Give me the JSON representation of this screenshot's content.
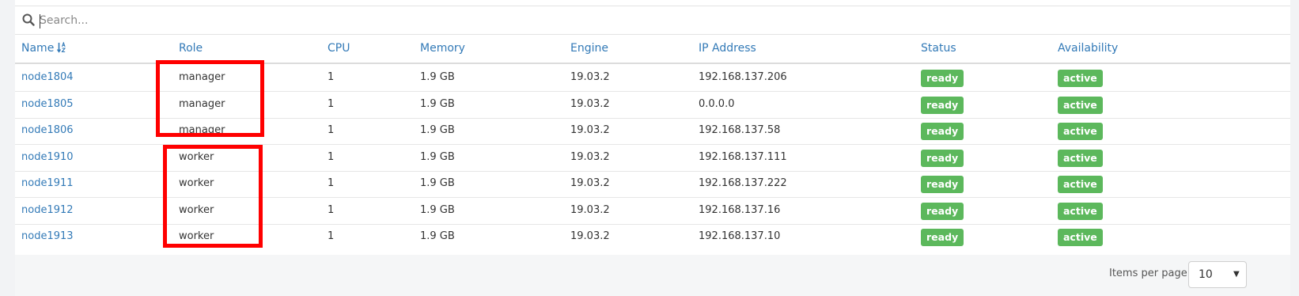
{
  "search": {
    "placeholder": "Search..."
  },
  "columns": {
    "name": "Name",
    "role": "Role",
    "cpu": "CPU",
    "memory": "Memory",
    "engine": "Engine",
    "ip": "IP Address",
    "status": "Status",
    "availability": "Availability"
  },
  "rows": [
    {
      "name": "node1804",
      "role": "manager",
      "cpu": "1",
      "memory": "1.9 GB",
      "engine": "19.03.2",
      "ip": "192.168.137.206",
      "status": "ready",
      "availability": "active"
    },
    {
      "name": "node1805",
      "role": "manager",
      "cpu": "1",
      "memory": "1.9 GB",
      "engine": "19.03.2",
      "ip": "0.0.0.0",
      "status": "ready",
      "availability": "active"
    },
    {
      "name": "node1806",
      "role": "manager",
      "cpu": "1",
      "memory": "1.9 GB",
      "engine": "19.03.2",
      "ip": "192.168.137.58",
      "status": "ready",
      "availability": "active"
    },
    {
      "name": "node1910",
      "role": "worker",
      "cpu": "1",
      "memory": "1.9 GB",
      "engine": "19.03.2",
      "ip": "192.168.137.111",
      "status": "ready",
      "availability": "active"
    },
    {
      "name": "node1911",
      "role": "worker",
      "cpu": "1",
      "memory": "1.9 GB",
      "engine": "19.03.2",
      "ip": "192.168.137.222",
      "status": "ready",
      "availability": "active"
    },
    {
      "name": "node1912",
      "role": "worker",
      "cpu": "1",
      "memory": "1.9 GB",
      "engine": "19.03.2",
      "ip": "192.168.137.16",
      "status": "ready",
      "availability": "active"
    },
    {
      "name": "node1913",
      "role": "worker",
      "cpu": "1",
      "memory": "1.9 GB",
      "engine": "19.03.2",
      "ip": "192.168.137.10",
      "status": "ready",
      "availability": "active"
    }
  ],
  "pagination": {
    "label": "Items per page",
    "value": "10"
  },
  "colors": {
    "link": "#337ab7",
    "label_success": "#5cb85c",
    "highlight": "#ff0000"
  },
  "icons": {
    "search": "search-icon",
    "sort": "sort-alpha-asc-icon",
    "select_caret": "caret-down-icon"
  }
}
